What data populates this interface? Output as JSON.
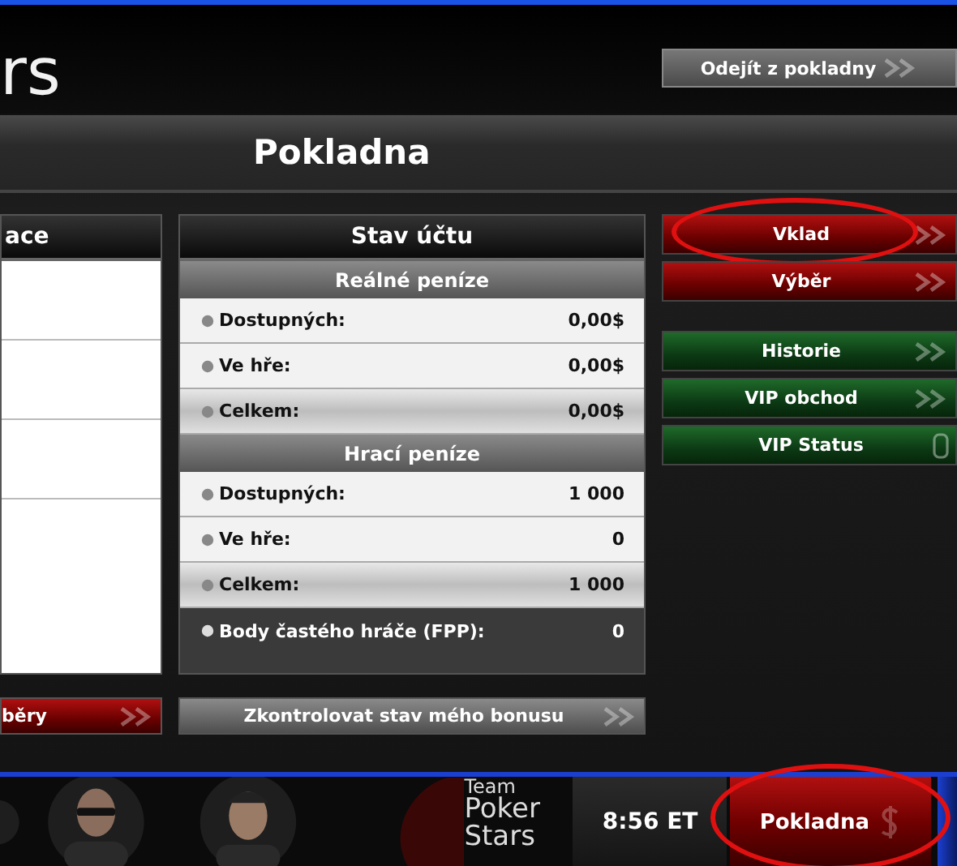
{
  "logo": {
    "text": "rs"
  },
  "exit_button": {
    "label": "Odejít z pokladny"
  },
  "title": "Pokladna",
  "left_panel": {
    "header": "ace"
  },
  "account": {
    "header": "Stav účtu",
    "sections": [
      {
        "title": "Reálné peníze",
        "rows": [
          {
            "label": "Dostupných:",
            "value": "0,00$",
            "kind": "plain"
          },
          {
            "label": "Ve hře:",
            "value": "0,00$",
            "kind": "plain"
          },
          {
            "label": "Celkem:",
            "value": "0,00$",
            "kind": "total"
          }
        ]
      },
      {
        "title": "Hrací peníze",
        "rows": [
          {
            "label": "Dostupných:",
            "value": "1 000",
            "kind": "plain"
          },
          {
            "label": "Ve hře:",
            "value": "0",
            "kind": "plain"
          },
          {
            "label": "Celkem:",
            "value": "1 000",
            "kind": "total"
          },
          {
            "label": "Body častého hráče (FPP):",
            "value": "0",
            "kind": "dark"
          }
        ]
      }
    ]
  },
  "action_groups": [
    [
      {
        "label": "Vklad",
        "kind": "red",
        "locked": false,
        "highlighted": true
      },
      {
        "label": "Výběr",
        "kind": "red",
        "locked": false,
        "highlighted": false
      }
    ],
    [
      {
        "label": "Historie",
        "kind": "green",
        "locked": false,
        "highlighted": false
      },
      {
        "label": "VIP obchod",
        "kind": "green",
        "locked": false,
        "highlighted": false
      },
      {
        "label": "VIP Status",
        "kind": "green",
        "locked": true,
        "highlighted": false
      }
    ]
  ],
  "bottom_buttons": [
    {
      "label": "běry",
      "kind": "red"
    },
    {
      "label": "Zkontrolovat stav mého bonusu",
      "kind": "grey"
    }
  ],
  "taskbar": {
    "team_logo": [
      "Team",
      "Poker",
      "Stars"
    ],
    "time": "8:56 ET",
    "cashier_button": {
      "label": "Pokladna",
      "highlighted": true
    }
  }
}
